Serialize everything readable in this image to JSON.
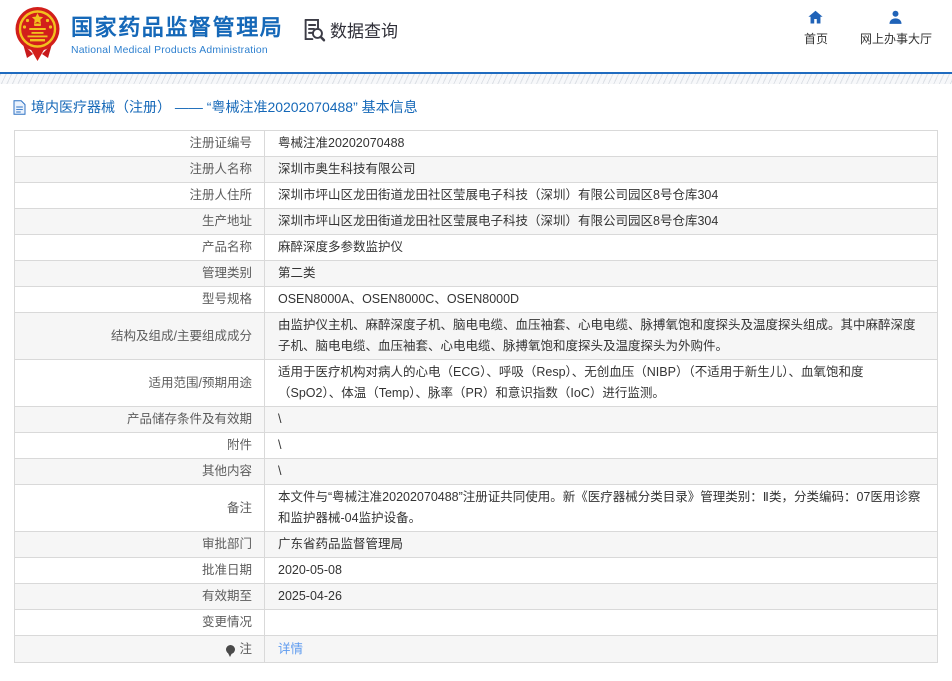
{
  "header": {
    "org_name_zh": "国家药品监督管理局",
    "org_name_en": "National Medical Products Administration",
    "section_label": "数据查询",
    "nav": [
      {
        "label": "首页",
        "icon": "home-icon"
      },
      {
        "label": "网上办事大厅",
        "icon": "person-icon"
      }
    ]
  },
  "page": {
    "title": "境内医疗器械（注册） —— “粤械注准20202070488” 基本信息"
  },
  "table": {
    "rows": [
      {
        "label": "注册证编号",
        "value": "粤械注准20202070488"
      },
      {
        "label": "注册人名称",
        "value": "深圳市奥生科技有限公司"
      },
      {
        "label": "注册人住所",
        "value": "深圳市坪山区龙田街道龙田社区莹展电子科技（深圳）有限公司园区8号仓库304"
      },
      {
        "label": "生产地址",
        "value": "深圳市坪山区龙田街道龙田社区莹展电子科技（深圳）有限公司园区8号仓库304"
      },
      {
        "label": "产品名称",
        "value": "麻醉深度多参数监护仪"
      },
      {
        "label": "管理类别",
        "value": "第二类"
      },
      {
        "label": "型号规格",
        "value": "OSEN8000A、OSEN8000C、OSEN8000D"
      },
      {
        "label": "结构及组成/主要组成成分",
        "value": "由监护仪主机、麻醉深度子机、脑电电缆、血压袖套、心电电缆、脉搏氧饱和度探头及温度探头组成。其中麻醉深度子机、脑电电缆、血压袖套、心电电缆、脉搏氧饱和度探头及温度探头为外购件。",
        "tall": true
      },
      {
        "label": "适用范围/预期用途",
        "value": "适用于医疗机构对病人的心电（ECG）、呼吸（Resp）、无创血压（NIBP）（不适用于新生儿）、血氧饱和度（SpO2）、体温（Temp）、脉率（PR）和意识指数（IoC）进行监测。",
        "tall": true
      },
      {
        "label": "产品储存条件及有效期",
        "value": "\\"
      },
      {
        "label": "附件",
        "value": "\\"
      },
      {
        "label": "其他内容",
        "value": "\\"
      },
      {
        "label": "备注",
        "value": "本文件与“粤械注准20202070488”注册证共同使用。新《医疗器械分类目录》管理类别：Ⅱ类，分类编码：07医用诊察和监护器械-04监护设备。",
        "tall": true
      },
      {
        "label": "审批部门",
        "value": "广东省药品监督管理局"
      },
      {
        "label": "批准日期",
        "value": "2020-05-08"
      },
      {
        "label": "有效期至",
        "value": "2025-04-26"
      },
      {
        "label": "变更情况",
        "value": ""
      },
      {
        "label": "注",
        "label_icon": "note-balloon-icon",
        "value": "详情",
        "link": true
      }
    ]
  },
  "colors": {
    "brand_blue": "#1568b8",
    "accent_blue": "#2063b8",
    "link_blue": "#5e9bef",
    "divider_blue": "#1f6bbf",
    "border_gray": "#d9d9d9",
    "alt_row_bg": "#f6f6f6",
    "label_text": "#5c5c5c",
    "value_text": "#333333",
    "emblem_red": "#d21f1b",
    "emblem_gold": "#f2c11e"
  }
}
